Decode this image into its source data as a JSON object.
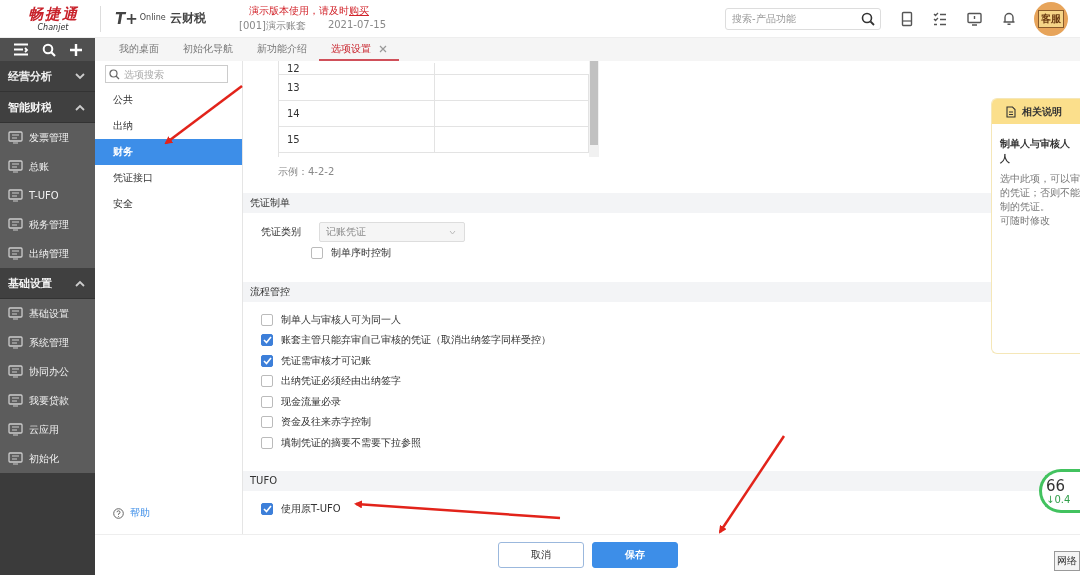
{
  "header": {
    "logo": "畅捷通",
    "logo_sub": "Chanjet",
    "product_mark": "T+",
    "product_mark_sub": "Online",
    "product": "云财税",
    "notice": "演示版本使用，请及时",
    "notice_link": "购买",
    "account": "[001]演示账套",
    "date": "2021-07-15",
    "search": {
      "placeholder": "搜索-产品功能"
    },
    "support_label": "客服"
  },
  "tabs": [
    {
      "label": "我的桌面",
      "selected": false
    },
    {
      "label": "初始化导航",
      "selected": false
    },
    {
      "label": "新功能介绍",
      "selected": false
    },
    {
      "label": "选项设置",
      "selected": true,
      "closable": true
    }
  ],
  "sidebar": {
    "groups": [
      {
        "label": "经营分析",
        "expanded": false
      },
      {
        "label": "智能财税",
        "expanded": true,
        "items": [
          "发票管理",
          "总账",
          "T-UFO",
          "税务管理",
          "出纳管理"
        ]
      },
      {
        "label": "基础设置",
        "expanded": true,
        "items": [
          "基础设置",
          "系统管理",
          "协同办公",
          "我要贷款",
          "云应用",
          "初始化"
        ]
      }
    ]
  },
  "options_nav": {
    "search_placeholder": "选项搜索",
    "items": [
      {
        "label": "公共",
        "selected": false
      },
      {
        "label": "出纳",
        "selected": false
      },
      {
        "label": "财务",
        "selected": true
      },
      {
        "label": "凭证接口",
        "selected": false
      },
      {
        "label": "安全",
        "selected": false
      }
    ],
    "help": "帮助"
  },
  "table": {
    "rows": [
      {
        "number": "12"
      },
      {
        "number": "13"
      },
      {
        "number": "14"
      },
      {
        "number": "15"
      }
    ]
  },
  "example": "示例：4-2-2",
  "sections": [
    {
      "title": "凭证制单",
      "fields": [
        {
          "kind": "select",
          "label": "凭证类别",
          "value": "记账凭证",
          "disabled": true
        },
        {
          "kind": "checkbox",
          "label": "制单序时控制",
          "checked": false
        }
      ]
    },
    {
      "title": "流程管控",
      "fields": [
        {
          "kind": "checkbox",
          "label": "制单人与审核人可为同一人",
          "checked": false
        },
        {
          "kind": "checkbox",
          "label": "账套主管只能弃审自己审核的凭证（取消出纳签字同样受控）",
          "checked": true
        },
        {
          "kind": "checkbox",
          "label": "凭证需审核才可记账",
          "checked": true
        },
        {
          "kind": "checkbox",
          "label": "出纳凭证必须经由出纳签字",
          "checked": false
        },
        {
          "kind": "checkbox",
          "label": "现金流量必录",
          "checked": false
        },
        {
          "kind": "checkbox",
          "label": "资金及往来赤字控制",
          "checked": false
        },
        {
          "kind": "checkbox",
          "label": "填制凭证的摘要不需要下拉参照",
          "checked": false
        }
      ]
    },
    {
      "title": "TUFO",
      "fields": [
        {
          "kind": "checkbox",
          "label": "使用原T-UFO",
          "checked": true
        }
      ]
    }
  ],
  "help_panel": {
    "title": "相关说明",
    "heading_lines": [
      "制单人与审核人",
      "人"
    ],
    "body_lines": [
      "选中此项，可以审",
      "的凭证；否则不能",
      "制的凭证。",
      "可随时修改"
    ]
  },
  "speed_widget": {
    "value": "66",
    "rate": "↓0.4"
  },
  "network_tag": "网络",
  "buttons": [
    {
      "label": "取消",
      "kind": "secondary"
    },
    {
      "label": "保存",
      "kind": "primary"
    }
  ]
}
